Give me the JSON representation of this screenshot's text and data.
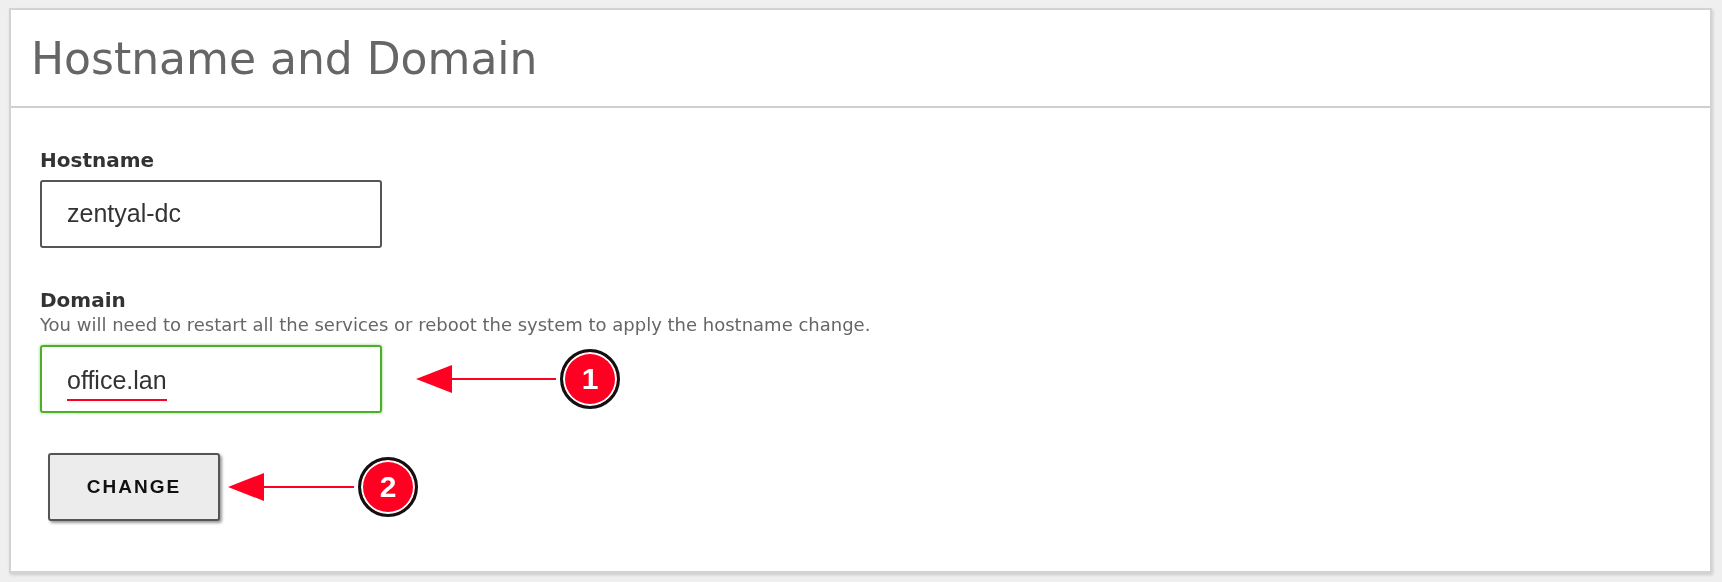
{
  "panel": {
    "title": "Hostname and Domain"
  },
  "fields": [
    {
      "label": "Hostname",
      "value": "zentyal-dc",
      "focused": false,
      "misspelled": false
    },
    {
      "label": "Domain",
      "help": "You will need to restart all the services or reboot the system to apply the hostname change.",
      "value": "office.lan",
      "focused": true,
      "misspelled": true,
      "callout": "1"
    }
  ],
  "button": {
    "label": "CHANGE",
    "callout": "2"
  }
}
